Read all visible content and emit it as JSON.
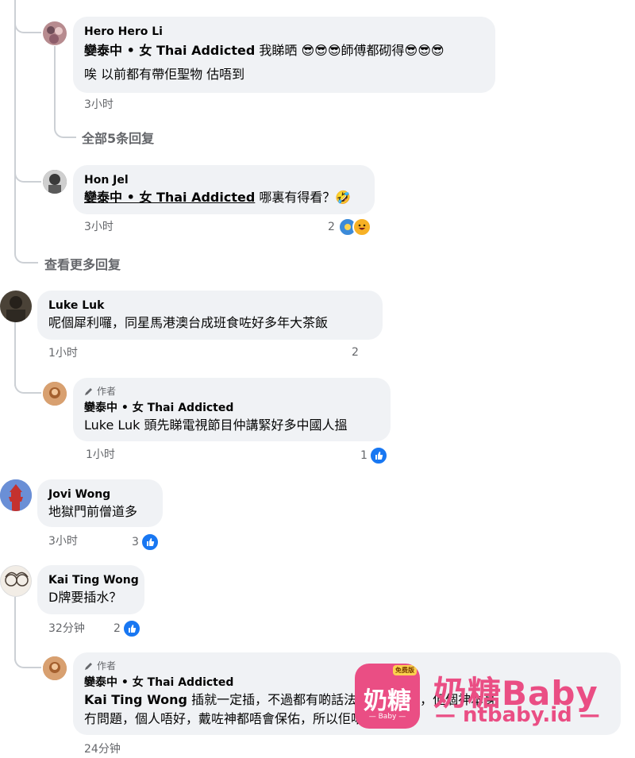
{
  "comments": {
    "hero": {
      "name": "Hero Hero Li",
      "tag": "孌泰中 • 女 Thai Addicted",
      "line1_tail": " 我睇晒 😎😎😎師傅都砌得😎😎😎",
      "line2": "唉 以前都有帶佢聖物 估唔到",
      "time": "3小时"
    },
    "view_all_replies": "全部5条回复",
    "hon": {
      "name": "Hon Jel",
      "tag": "孌泰中 • 女 Thai Addicted",
      "text_tail": " 哪裏有得看？🤣",
      "time": "3小时",
      "reactions": "2"
    },
    "view_more_replies": "查看更多回复",
    "luke": {
      "name": "Luke Luk",
      "text": "呢個犀利囉，同星馬港澳台成班食咗好多年大茶飯",
      "time": "1小时",
      "reactions": "2"
    },
    "author_reply1": {
      "author_label": "作者",
      "name": "孌泰中 • 女 Thai Addicted",
      "text": "Luke Luk 頭先睇電視節目仲講緊好多中國人搵",
      "time": "1小时",
      "reactions": "1"
    },
    "jovi": {
      "name": "Jovi Wong",
      "text": "地獄門前僧道多",
      "time": "3小时",
      "reactions": "3"
    },
    "kai": {
      "name": "Kai Ting Wong",
      "text": "D牌要插水？",
      "time": "32分钟",
      "reactions": "2"
    },
    "author_reply2": {
      "author_label": "作者",
      "name": "孌泰中 • 女 Thai Addicted",
      "tag": "Kai Ting Wong",
      "line1_tail": " 插就一定插，不過都有啲話法師傅有問題，但個神本身",
      "line2": "冇問題，個人唔好，戴咗神都唔會保佑，所以佢啱喎",
      "time": "24分钟"
    }
  },
  "watermark": {
    "badge": "免费版",
    "app_text": "奶糖",
    "app_sub": "— Baby —",
    "title": "奶糖Baby",
    "url": "— ntbaby.id —"
  },
  "colors": {
    "bubble": "#f0f2f5",
    "thread_line": "#ccd0d5",
    "meta": "#65676b",
    "like_blue": "#1877f2",
    "watermark_pink": "#ea4e84"
  }
}
